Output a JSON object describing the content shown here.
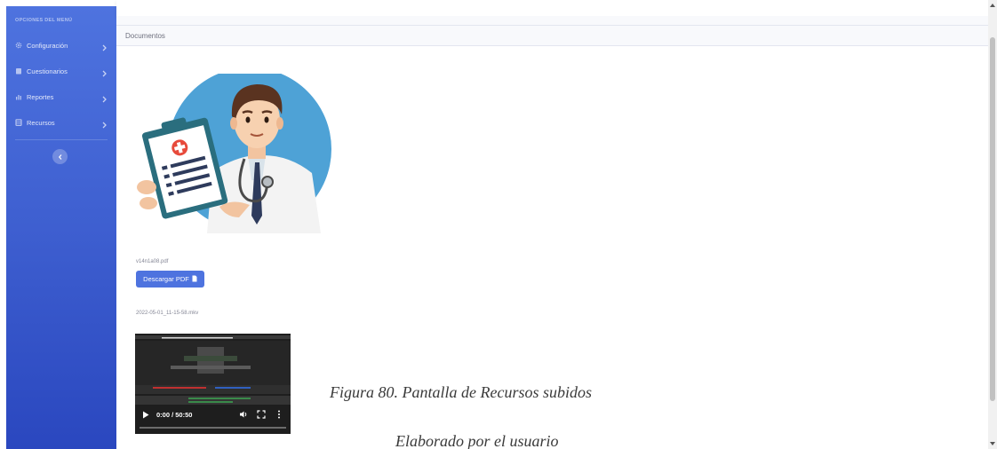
{
  "sidebar": {
    "heading": "OPCIONES DEL MENÚ",
    "items": [
      {
        "label": "Configuración",
        "icon": "gear-icon"
      },
      {
        "label": "Cuestionarios",
        "icon": "clipboard-icon"
      },
      {
        "label": "Reportes",
        "icon": "chart-icon"
      },
      {
        "label": "Recursos",
        "icon": "book-icon"
      }
    ],
    "toggle_icon": "chevron-left-icon"
  },
  "card": {
    "title": "Documentos"
  },
  "resources": {
    "pdf_filename": "v14n1a08.pdf",
    "pdf_button_label": "Descargar PDF",
    "video_filename": "2022-05-01_11-15-58.mkv",
    "video_time": "0:00 / 50:50",
    "video_progress": 0
  },
  "caption": {
    "figure": "Figura 80. Pantalla de Recursos subidos",
    "credit": "Elaborado por el usuario"
  },
  "colors": {
    "sidebar": "#4e73df",
    "button": "#4e73df",
    "header_bg": "#f8f9fc"
  }
}
